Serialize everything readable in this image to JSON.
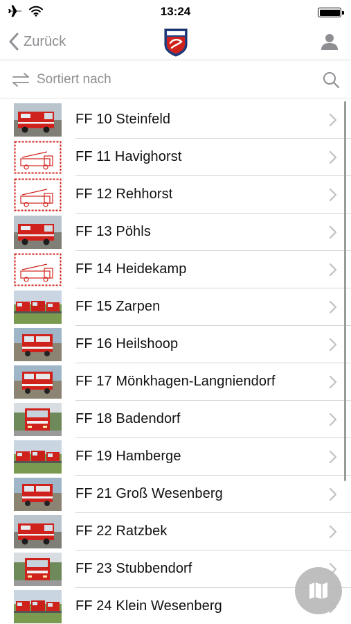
{
  "status_bar": {
    "time": "13:24",
    "icons": [
      "airplane-icon",
      "wifi-icon",
      "battery-icon"
    ]
  },
  "nav": {
    "back_label": "Zurück",
    "logo": "fire-department-crest",
    "profile_icon": "person-icon"
  },
  "sort": {
    "label": "Sortiert nach",
    "sort_icon": "swap-arrows-icon",
    "search_icon": "search-icon"
  },
  "items": [
    {
      "label": "FF 10 Steinfeld",
      "thumb": "truck-red-van"
    },
    {
      "label": "FF 11 Havighorst",
      "thumb": "drawing"
    },
    {
      "label": "FF 12 Rehhorst",
      "thumb": "drawing"
    },
    {
      "label": "FF 13 Pöhls",
      "thumb": "truck-red-van"
    },
    {
      "label": "FF 14 Heidekamp",
      "thumb": "drawing"
    },
    {
      "label": "FF 15 Zarpen",
      "thumb": "trucks-field"
    },
    {
      "label": "FF 16 Heilshoop",
      "thumb": "truck-big"
    },
    {
      "label": "FF 17 Mönkhagen-Langniendorf",
      "thumb": "truck-big"
    },
    {
      "label": "FF 18 Badendorf",
      "thumb": "truck-front"
    },
    {
      "label": "FF 19 Hamberge",
      "thumb": "trucks-field"
    },
    {
      "label": "FF 21 Groß Wesenberg",
      "thumb": "truck-big"
    },
    {
      "label": "FF 22 Ratzbek",
      "thumb": "truck-red-van"
    },
    {
      "label": "FF 23 Stubbendorf",
      "thumb": "truck-front"
    },
    {
      "label": "FF 24 Klein Wesenberg",
      "thumb": "trucks-field"
    }
  ],
  "map_button": {
    "icon": "map-icon"
  },
  "colors": {
    "accent_gray": "#8e8e93",
    "fire_red": "#d0221c",
    "separator": "#d6d6d6"
  }
}
